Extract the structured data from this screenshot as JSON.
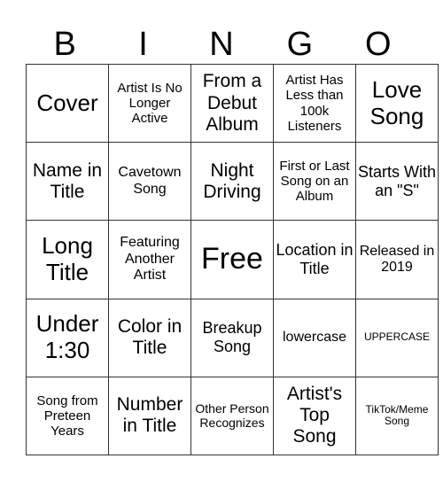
{
  "card": {
    "header": [
      "B",
      "I",
      "N",
      "G",
      "O"
    ],
    "rows": [
      [
        "Cover",
        "Artist Is No Longer Active",
        "From a Debut Album",
        "Artist Has Less than 100k Listeners",
        "Love Song"
      ],
      [
        "Name in Title",
        "Cavetown Song",
        "Night Driving",
        "First or Last Song on an Album",
        "Starts With an \"S\""
      ],
      [
        "Long Title",
        "Featuring Another Artist",
        "Free",
        "Location in Title",
        "Released in 2019"
      ],
      [
        "Under 1:30",
        "Color in Title",
        "Breakup Song",
        "lowercase",
        "UPPERCASE"
      ],
      [
        "Song from Preteen Years",
        "Number in Title",
        "Other Person Recognizes",
        "Artist's Top Song",
        "TikTok/Meme Song"
      ]
    ]
  }
}
